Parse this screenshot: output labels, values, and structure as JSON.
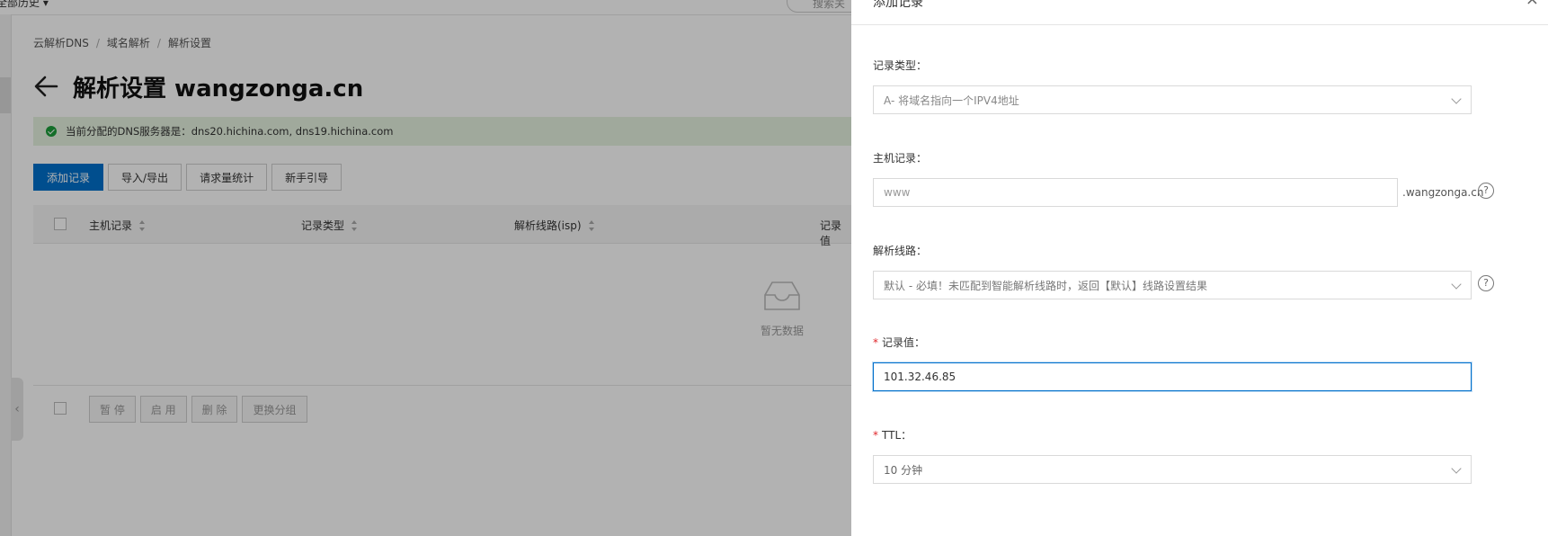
{
  "topbar": {
    "filter_label": "全部历史 ▾",
    "search_placeholder": "搜索关"
  },
  "breadcrumb": [
    "云解析DNS",
    "域名解析",
    "解析设置"
  ],
  "page_title": "解析设置 wangzonga.cn",
  "notice": "当前分配的DNS服务器是：dns20.hichina.com, dns19.hichina.com",
  "toolbar": [
    "添加记录",
    "导入/导出",
    "请求量统计",
    "新手引导"
  ],
  "table": {
    "columns": [
      "主机记录",
      "记录类型",
      "解析线路(isp)",
      "记录值"
    ],
    "empty_text": "暂无数据"
  },
  "footer_buttons": [
    "暂 停",
    "启 用",
    "删 除",
    "更换分组"
  ],
  "drawer": {
    "title": "添加记录",
    "close_icon": "×",
    "record_type": {
      "label": "记录类型：",
      "value": "A- 将域名指向一个IPV4地址"
    },
    "host": {
      "label": "主机记录：",
      "placeholder": "www",
      "suffix": ".wangzonga.cn"
    },
    "line": {
      "label": "解析线路：",
      "value": "默认 - 必填！未匹配到智能解析线路时，返回【默认】线路设置结果"
    },
    "record_value": {
      "label": "记录值：",
      "value": "101.32.46.85",
      "required_mark": "*"
    },
    "ttl": {
      "label": "TTL：",
      "value": "10 分钟",
      "required_mark": "*"
    },
    "help_glyph": "?"
  },
  "colors": {
    "primary": "#0070cc",
    "required": "#e0262b",
    "success": "#1c9e3a"
  }
}
